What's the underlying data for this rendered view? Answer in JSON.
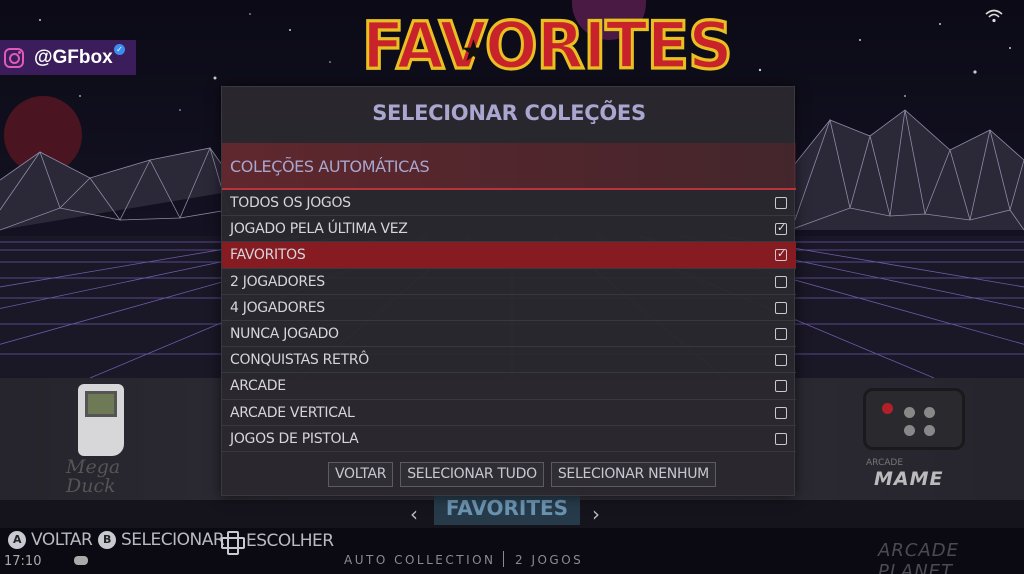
{
  "overlay": {
    "social_handle": "@GFbox",
    "icons": [
      "instagram-icon",
      "verified-icon",
      "wifi-icon"
    ]
  },
  "background": {
    "view_logo_text": "FAVORITES",
    "left_system_name": "Mega Duck",
    "right_system_label": "ARCADE",
    "right_system_name": "MAME",
    "current_logo_text": "FAVORITES",
    "colors": {
      "logo_red": "#c8232a",
      "logo_outline": "#e8c021",
      "grid_purple": "#6c5aa8"
    }
  },
  "dialog": {
    "title": "SELECIONAR COLEÇÕES",
    "section_label": "COLEÇÕES AUTOMÁTICAS",
    "items": [
      {
        "label": "TODOS OS JOGOS",
        "checked": false,
        "selected": false
      },
      {
        "label": "JOGADO PELA ÚLTIMA VEZ",
        "checked": true,
        "selected": false
      },
      {
        "label": "FAVORITOS",
        "checked": true,
        "selected": true
      },
      {
        "label": "2 JOGADORES",
        "checked": false,
        "selected": false
      },
      {
        "label": "4 JOGADORES",
        "checked": false,
        "selected": false
      },
      {
        "label": "NUNCA JOGADO",
        "checked": false,
        "selected": false
      },
      {
        "label": "CONQUISTAS RETRÔ",
        "checked": false,
        "selected": false
      },
      {
        "label": "ARCADE",
        "checked": false,
        "selected": false
      },
      {
        "label": "ARCADE VERTICAL",
        "checked": false,
        "selected": false
      },
      {
        "label": "JOGOS DE PISTOLA",
        "checked": false,
        "selected": false
      }
    ],
    "buttons": {
      "back": "VOLTAR",
      "select_all": "SELECIONAR TUDO",
      "select_none": "SELECIONAR NENHUM"
    },
    "colors": {
      "selected_row": "#861c22",
      "title": "#a9a6cf",
      "accent_line": "#b8333b"
    }
  },
  "help": {
    "items": [
      {
        "button": "A",
        "label": "VOLTAR"
      },
      {
        "button": "B",
        "label": "SELECIONAR"
      },
      {
        "button": "dpad",
        "label": "ESCOLHER"
      }
    ],
    "clock": "17:10",
    "collection_type": "AUTO COLLECTION",
    "game_count": "2 JOGOS",
    "brand": "ARCADE  PLANET"
  }
}
